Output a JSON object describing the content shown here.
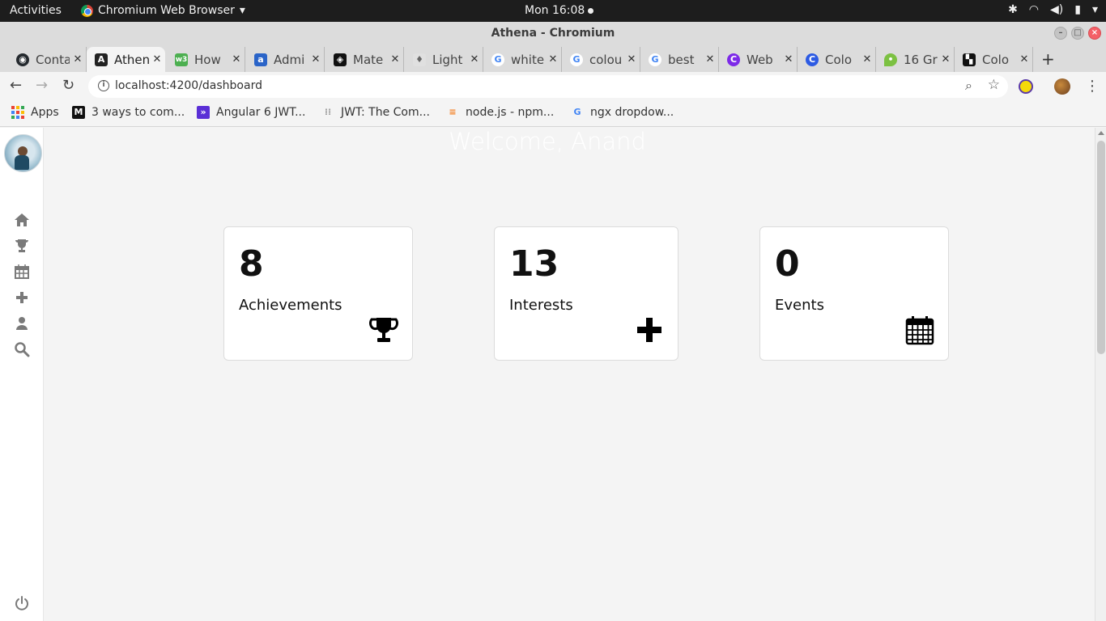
{
  "system": {
    "activities": "Activities",
    "app_name": "Chromium Web Browser",
    "clock": "Mon 16:08"
  },
  "window": {
    "title": "Athena - Chromium"
  },
  "tabs": [
    {
      "label": "Conta",
      "icon": "github-icon",
      "color": "#24292e"
    },
    {
      "label": "Athena",
      "icon": "angular-icon",
      "color": "#222222",
      "active": true
    },
    {
      "label": "How",
      "icon": "w3-icon",
      "color": "#4caf50"
    },
    {
      "label": "Admi",
      "icon": "admin-icon",
      "color": "#2a64c8"
    },
    {
      "label": "Mate",
      "icon": "codepen-icon",
      "color": "#111111"
    },
    {
      "label": "Light",
      "icon": "bulb-icon",
      "color": "#9e9e9e"
    },
    {
      "label": "white",
      "icon": "google-icon",
      "color": "#4285f4"
    },
    {
      "label": "colou",
      "icon": "google-icon",
      "color": "#4285f4"
    },
    {
      "label": "best",
      "icon": "google-icon",
      "color": "#4285f4"
    },
    {
      "label": "Web",
      "icon": "canva-icon",
      "color": "#7d2ae8"
    },
    {
      "label": "Colo",
      "icon": "canva-icon",
      "color": "#2d5be3"
    },
    {
      "label": "16 Gr",
      "icon": "pin-icon",
      "color": "#7cc142"
    },
    {
      "label": "Colo",
      "icon": "palette-icon",
      "color": "#111111"
    }
  ],
  "toolbar": {
    "url": "localhost:4200/dashboard"
  },
  "bookmarks": [
    {
      "label": "Apps",
      "icon": "apps-grid-icon"
    },
    {
      "label": "3 ways to com...",
      "icon": "medium-icon",
      "color": "#111111"
    },
    {
      "label": "Angular 6 JWT...",
      "icon": "bookmark-purple-icon",
      "color": "#5a2fd6"
    },
    {
      "label": "JWT: The Com...",
      "icon": "jwt-icon",
      "color": "#9e9e9e"
    },
    {
      "label": "node.js - npm...",
      "icon": "stackoverflow-icon",
      "color": "#f48024"
    },
    {
      "label": "ngx dropdow...",
      "icon": "google-icon",
      "color": "#4285f4"
    }
  ],
  "page": {
    "welcome": "Welcome, Anand",
    "cards": [
      {
        "value": "8",
        "label": "Achievements",
        "icon": "trophy-icon"
      },
      {
        "value": "13",
        "label": "Interests",
        "icon": "plus-icon"
      },
      {
        "value": "0",
        "label": "Events",
        "icon": "calendar-icon"
      }
    ]
  }
}
